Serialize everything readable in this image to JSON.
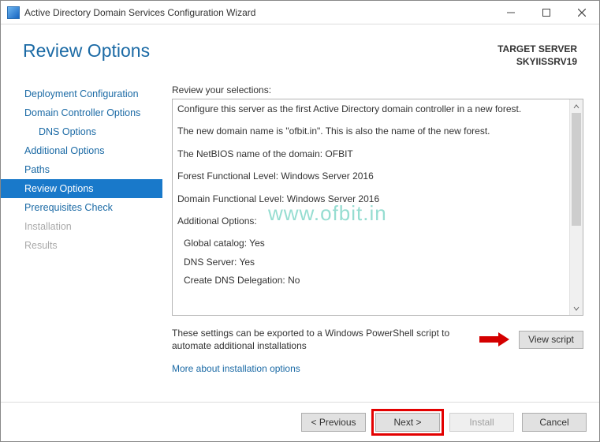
{
  "window": {
    "title": "Active Directory Domain Services Configuration Wizard"
  },
  "header": {
    "title": "Review Options",
    "target_label": "TARGET SERVER",
    "target_server": "SKYIISSRV19"
  },
  "sidebar": {
    "items": [
      {
        "label": "Deployment Configuration",
        "selected": false,
        "disabled": false,
        "sub": false
      },
      {
        "label": "Domain Controller Options",
        "selected": false,
        "disabled": false,
        "sub": false
      },
      {
        "label": "DNS Options",
        "selected": false,
        "disabled": false,
        "sub": true
      },
      {
        "label": "Additional Options",
        "selected": false,
        "disabled": false,
        "sub": false
      },
      {
        "label": "Paths",
        "selected": false,
        "disabled": false,
        "sub": false
      },
      {
        "label": "Review Options",
        "selected": true,
        "disabled": false,
        "sub": false
      },
      {
        "label": "Prerequisites Check",
        "selected": false,
        "disabled": false,
        "sub": false
      },
      {
        "label": "Installation",
        "selected": false,
        "disabled": true,
        "sub": false
      },
      {
        "label": "Results",
        "selected": false,
        "disabled": true,
        "sub": false
      }
    ]
  },
  "main": {
    "instruction": "Review your selections:",
    "review_lines": [
      "Configure this server as the first Active Directory domain controller in a new forest.",
      "The new domain name is \"ofbit.in\". This is also the name of the new forest.",
      "The NetBIOS name of the domain: OFBIT",
      "Forest Functional Level: Windows Server 2016",
      "Domain Functional Level: Windows Server 2016",
      "Additional Options:",
      "Global catalog: Yes",
      "DNS Server: Yes",
      "Create DNS Delegation: No"
    ],
    "export_text": "These settings can be exported to a Windows PowerShell script to automate additional installations",
    "view_script_label": "View script",
    "more_link": "More about installation options"
  },
  "footer": {
    "previous": "< Previous",
    "next": "Next >",
    "install": "Install",
    "cancel": "Cancel"
  },
  "watermark": "www.ofbit.in"
}
